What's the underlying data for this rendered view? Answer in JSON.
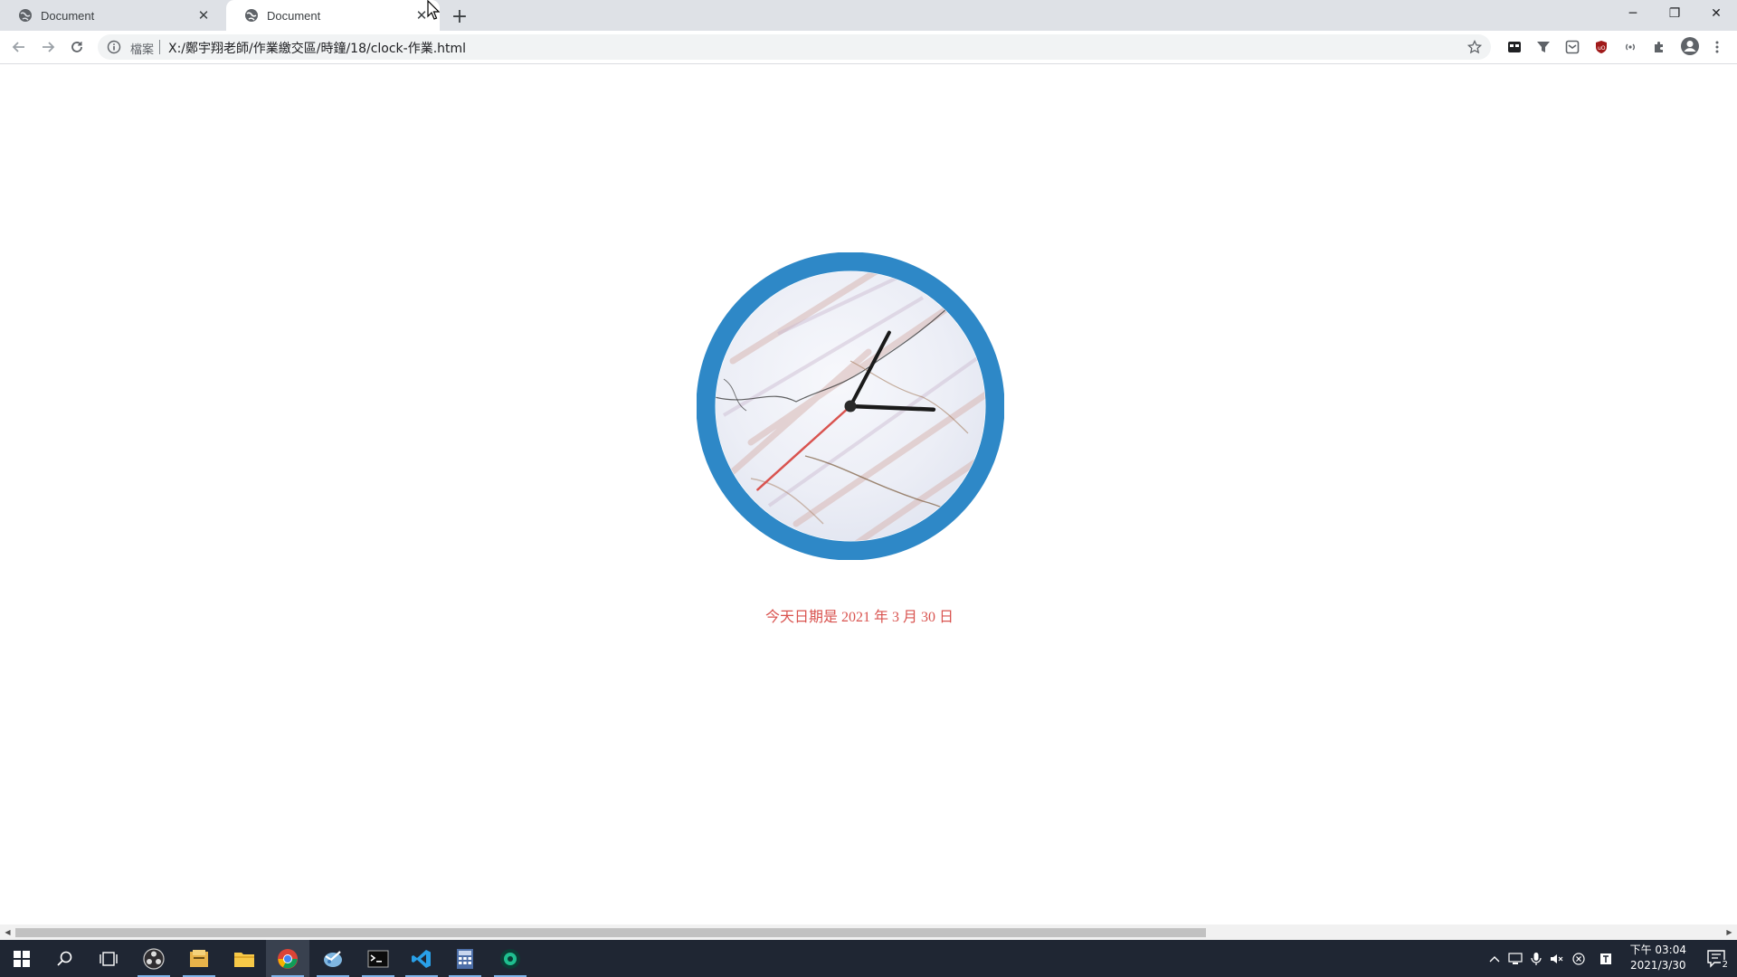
{
  "browser": {
    "tabs": [
      {
        "title": "Document",
        "active": false
      },
      {
        "title": "Document",
        "active": true
      }
    ],
    "address": {
      "site_label": "檔案",
      "url": "X:/鄭宇翔老師/作業繳交區/時鐘/18/clock-作業.html"
    }
  },
  "page": {
    "clock": {
      "hour": 3,
      "minute": 4,
      "second": 38
    },
    "date_text": "今天日期是 2021 年 3 月 30 日"
  },
  "colors": {
    "clock_ring": "#2e88c7",
    "second_hand": "#d9534f",
    "date_text": "#d9534f"
  },
  "taskbar": {
    "apps": [
      "windows-start",
      "search",
      "task-view",
      "obs-studio",
      "file-manager",
      "file-explorer",
      "chrome",
      "app-icon",
      "terminal",
      "vscode",
      "calculator",
      "other-app"
    ],
    "time": "下午 03:04",
    "date": "2021/3/30",
    "notifications": "2"
  }
}
